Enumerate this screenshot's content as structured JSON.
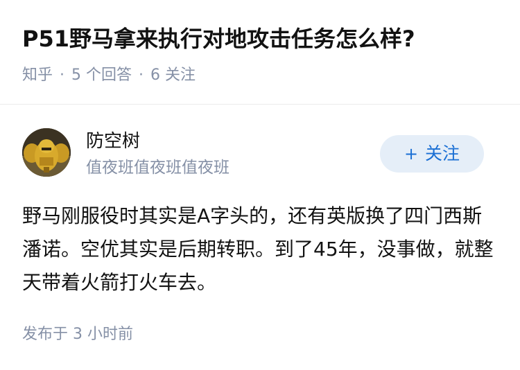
{
  "question": {
    "title": "P51野马拿来执行对地攻击任务怎么样?",
    "source": "知乎",
    "separator": "·",
    "answers_count": "5 个回答",
    "followers_count": "6 关注"
  },
  "answer": {
    "author_name": "防空树",
    "author_bio": "值夜班值夜班值夜班",
    "follow_icon": "+",
    "follow_label": "关注",
    "content": "野马刚服役时其实是A字头的，还有英版换了四门西斯潘诺。空优其实是后期转职。到了45年，没事做，就整天带着火箭打火车去。",
    "published_time": "发布于 3 小时前"
  },
  "colors": {
    "accent": "#1a6fd4",
    "follow_bg": "#e5eef8",
    "meta_text": "#8590a6",
    "divider": "#ebebeb"
  }
}
